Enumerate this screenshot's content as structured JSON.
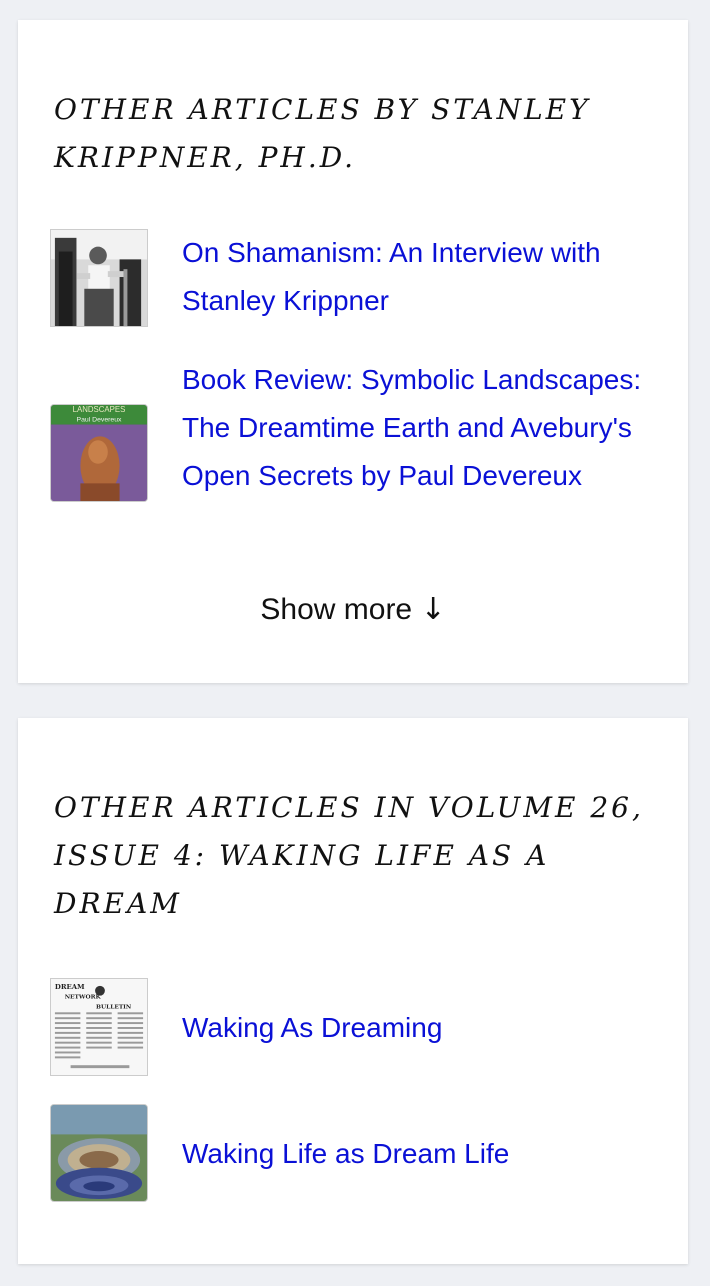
{
  "section_by_author": {
    "heading": "OTHER ARTICLES BY STANLEY KRIPPNER, PH.D.",
    "items": [
      {
        "title": "On Shamanism: An Interview with Stanley Krippner",
        "thumbnail": "black-and-white photo of man with drums"
      },
      {
        "title": "Book Review: Symbolic Landscapes: The Dreamtime Earth and Avebury's Open Secrets by Paul Devereux",
        "thumbnail": "book cover",
        "thumb_text": {
          "title": "LANDSCAPES",
          "author": "Paul Devereux"
        }
      }
    ],
    "show_more_label": "Show more",
    "show_more_arrow": "↓"
  },
  "section_in_issue": {
    "heading": "OTHER ARTICLES IN VOLUME 26, ISSUE 4: WAKING LIFE AS A DREAM",
    "items": [
      {
        "title": "Waking As Dreaming",
        "thumbnail": "newsletter page scan",
        "thumb_text": {
          "line1": "DREAM",
          "line2": "NETWORK",
          "line3": "BULLETIN"
        }
      },
      {
        "title": "Waking Life as Dream Life",
        "thumbnail": "painting of sleeping figure in swirling landscape"
      }
    ]
  },
  "colors": {
    "link": "#0a10d6",
    "card": "#ffffff",
    "page": "#eef0f4",
    "text": "#111111"
  }
}
